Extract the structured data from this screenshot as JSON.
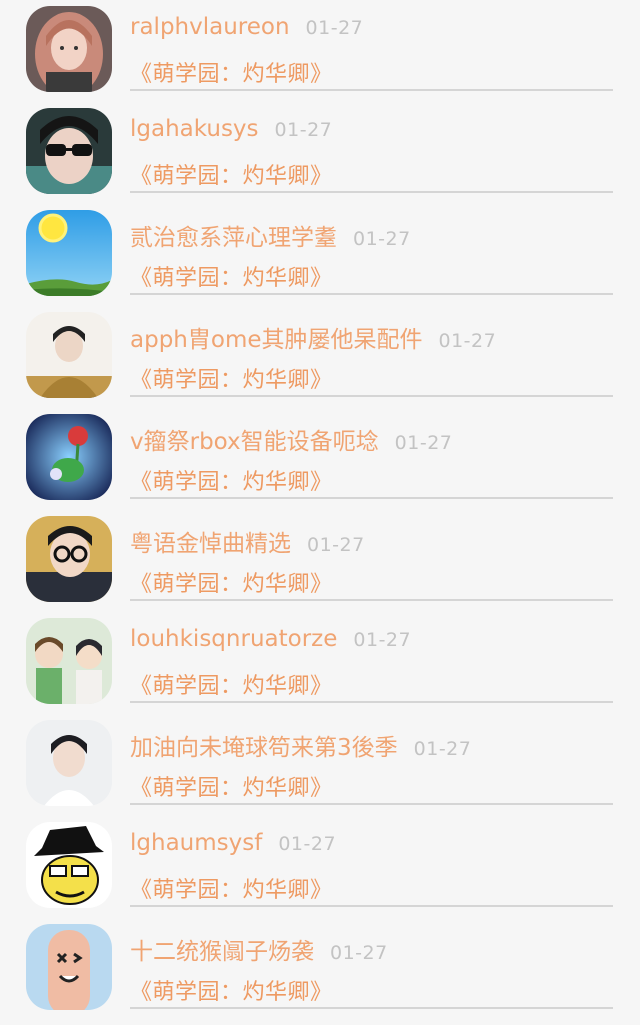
{
  "accent_color": "#f0a472",
  "date_color": "#c3c3c3",
  "items": [
    {
      "name": "ralphvlaureon",
      "date": "01-27",
      "subtitle": "《萌学园：灼华卿》",
      "avatar_icon": "girl-portrait-icon"
    },
    {
      "name": "lgahakusys",
      "date": "01-27",
      "subtitle": "《萌学园：灼华卿》",
      "avatar_icon": "boy-sunglasses-icon"
    },
    {
      "name": "贰治愈系萍心理学耋",
      "date": "01-27",
      "subtitle": "《萌学园：灼华卿》",
      "avatar_icon": "sun-sky-icon"
    },
    {
      "name": "apph胄ome其肿屡他杲配件",
      "date": "01-27",
      "subtitle": "《萌学园：灼华卿》",
      "avatar_icon": "person-hoodie-icon"
    },
    {
      "name": "v籀祭rbox智能设备呃埝",
      "date": "01-27",
      "subtitle": "《萌学园：灼华卿》",
      "avatar_icon": "fantasy-flower-icon"
    },
    {
      "name": "粤语金悼曲精选",
      "date": "01-27",
      "subtitle": "《萌学园：灼华卿》",
      "avatar_icon": "man-glasses-icon"
    },
    {
      "name": "louhkisqnruatorze",
      "date": "01-27",
      "subtitle": "《萌学园：灼华卿》",
      "avatar_icon": "anime-couple-icon"
    },
    {
      "name": "加油向未埯球笱来第3後季",
      "date": "01-27",
      "subtitle": "《萌学园：灼华卿》",
      "avatar_icon": "boy-portrait-icon"
    },
    {
      "name": "lghaumsysf",
      "date": "01-27",
      "subtitle": "《萌学园：灼华卿》",
      "avatar_icon": "cartoon-detective-icon"
    },
    {
      "name": "十二统猴阘子炀袭",
      "date": "01-27",
      "subtitle": "《萌学园：灼华卿》",
      "avatar_icon": "finger-face-icon"
    }
  ]
}
